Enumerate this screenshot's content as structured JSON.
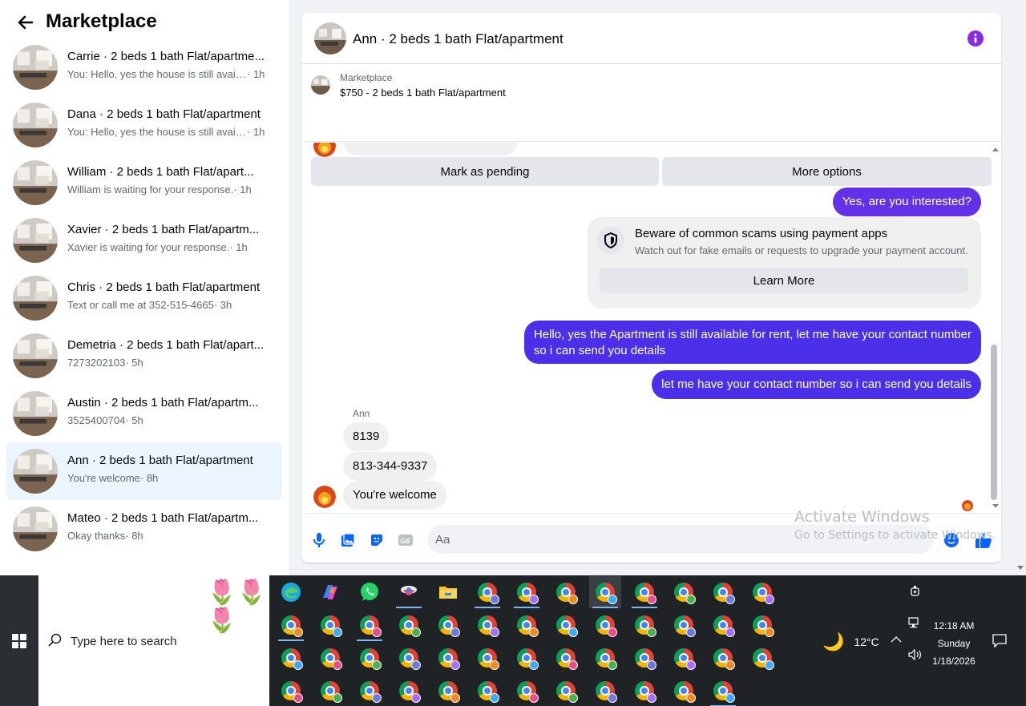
{
  "sidebar": {
    "title": "Marketplace",
    "conversations": [
      {
        "name": "Carrie · 2 beds 1 bath Flat/apartme...",
        "snippet": "You: Hello, yes the house is still availa...",
        "time": " · 1h"
      },
      {
        "name": "Dana · 2 beds 1 bath Flat/apartment",
        "snippet": "You: Hello, yes the house is still availa...",
        "time": " · 1h"
      },
      {
        "name": "William · 2 beds 1 bath Flat/apart...",
        "snippet": "William is waiting for your response.",
        "time": " · 1h"
      },
      {
        "name": "Xavier · 2 beds 1 bath Flat/apartm...",
        "snippet": "Xavier is waiting for your response.",
        "time": " · 1h"
      },
      {
        "name": "Chris · 2 beds 1 bath Flat/apartment",
        "snippet": "Text or call me at 352-515-4665",
        "time": " · 3h"
      },
      {
        "name": "Demetria · 2 beds 1 bath Flat/apart...",
        "snippet": "7273202103",
        "time": " · 5h"
      },
      {
        "name": "Austin · 2 beds 1 bath Flat/apartm...",
        "snippet": "3525400704",
        "time": " · 5h"
      },
      {
        "name": "Ann · 2 beds 1 bath Flat/apartment",
        "snippet": "You're welcome",
        "time": " · 8h"
      },
      {
        "name": "Mateo · 2 beds 1 bath Flat/apartm...",
        "snippet": "Okay thanks",
        "time": " · 8h"
      }
    ],
    "active_index": 7
  },
  "chat": {
    "title": "Ann · 2 beds 1 bath Flat/apartment",
    "listing_label": "Marketplace",
    "listing_price": "$750 - 2 beds 1 bath Flat/apartment",
    "mark_pending_label": "Mark as pending",
    "more_options_label": "More options",
    "messages": {
      "out1": "Yes, are you interested?",
      "scam_title": "Beware of common scams using payment apps",
      "scam_sub": "Watch out for fake emails or requests to upgrade your payment account.",
      "learn_more": "Learn More",
      "out2_line1": "Hello, yes the Apartment is still available for rent, let me have your contact number",
      "out2_line2": "so i can send you details",
      "out3": "let me have your contact number so i can send you details",
      "sender": "Ann",
      "in1": "8139",
      "in2": "813-344-9337",
      "in3": "You're welcome"
    },
    "input_placeholder": "Aa"
  },
  "watermark": {
    "line1": "Activate Windows",
    "line2": "Go to Settings to activate Windows."
  },
  "taskbar": {
    "search_placeholder": "Type here to search",
    "temperature": "12°C",
    "time": "12:18 AM",
    "day": "Sunday",
    "date": "1/18/2026"
  },
  "colors": {
    "accent": "#6231e8",
    "accent2": "#4b2fe9",
    "info": "#8a2be2"
  }
}
